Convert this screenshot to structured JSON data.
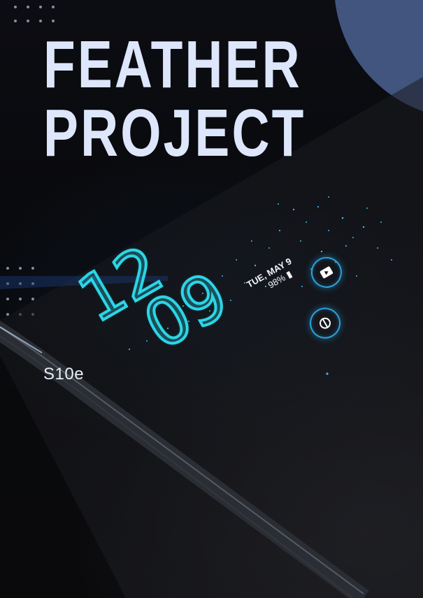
{
  "poster": {
    "title_line1": "FEATHER",
    "title_line2": "PROJECT",
    "device_label": "S10e"
  },
  "lock_screen": {
    "hour": "12",
    "minute": "09",
    "date": "TUE, MAY 9",
    "battery": "98%"
  },
  "colors": {
    "background": "#08090c",
    "circle_accent": "#41557e",
    "title_text": "#dde6fb",
    "clock_cyan": "#2cd5e6",
    "button_ring": "#2aa3e0"
  },
  "icons": {
    "shortcut_1": "video-play-icon",
    "shortcut_2": "circle-slash-icon"
  }
}
